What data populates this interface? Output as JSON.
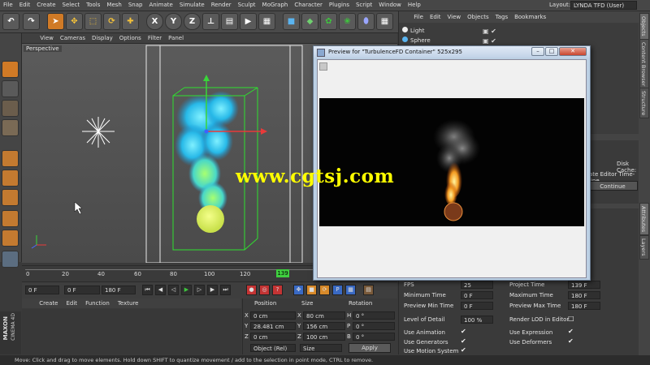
{
  "menu": [
    "File",
    "Edit",
    "Create",
    "Select",
    "Tools",
    "Mesh",
    "Snap",
    "Animate",
    "Simulate",
    "Render",
    "Sculpt",
    "MoGraph",
    "Character",
    "Plugins",
    "Script",
    "Window",
    "Help"
  ],
  "layout": {
    "label": "Layout:",
    "value": "LYNDA TFD (User)"
  },
  "toolbar_axis": [
    "X",
    "Y",
    "Z"
  ],
  "viewport": {
    "menu": [
      "View",
      "Cameras",
      "Display",
      "Options",
      "Filter",
      "Panel"
    ],
    "label": "Perspective"
  },
  "timeline": {
    "ticks": [
      "0",
      "20",
      "40",
      "60",
      "80",
      "100",
      "120",
      "140"
    ],
    "current": "139"
  },
  "transport": {
    "start": "0 F",
    "current": "0 F",
    "end": "180 F"
  },
  "material_menu": [
    "Create",
    "Edit",
    "Function",
    "Texture"
  ],
  "coords": {
    "headers": [
      "Position",
      "Size",
      "Rotation"
    ],
    "rows": [
      {
        "axis": "X",
        "pos": "0 cm",
        "size": "80 cm",
        "rot_axis": "H",
        "rot": "0 °"
      },
      {
        "axis": "Y",
        "pos": "28.481 cm",
        "size": "156 cm",
        "rot_axis": "P",
        "rot": "0 °"
      },
      {
        "axis": "Z",
        "pos": "0 cm",
        "size": "100 cm",
        "rot_axis": "B",
        "rot": "0 °"
      }
    ],
    "mode": "Object (Rel)",
    "size_mode": "Size",
    "apply": "Apply"
  },
  "brand": {
    "line1": "MAXON",
    "line2": "CINEMA 4D"
  },
  "status": "Move: Click and drag to move elements. Hold down SHIFT to quantize movement / add to the selection in point mode, CTRL to remove.",
  "objects": {
    "menu": [
      "File",
      "Edit",
      "View",
      "Objects",
      "Tags",
      "Bookmarks"
    ],
    "items": [
      "Light",
      "Sphere"
    ]
  },
  "side_tabs_top": [
    "Objects",
    "Content Browser",
    "Structure"
  ],
  "side_tabs_bottom": [
    "Attributes",
    "Layers"
  ],
  "attributes": {
    "disk_cache": "Disk Cache:",
    "editor_timeline": "ate Editor Time-line",
    "continue": "Continue",
    "rows_left": [
      {
        "label": "FPS",
        "value": "25"
      },
      {
        "label": "Minimum Time",
        "value": "0 F"
      },
      {
        "label": "Preview Min Time",
        "value": "0 F"
      }
    ],
    "rows_right": [
      {
        "label": "Project Time",
        "value": "139 F"
      },
      {
        "label": "Maximum Time",
        "value": "180 F"
      },
      {
        "label": "Preview Max Time",
        "value": "180 F"
      }
    ],
    "lod_label": "Level of Detail",
    "lod_value": "100 %",
    "render_lod": "Render LOD in Editor",
    "checks_left": [
      "Use Animation",
      "Use Generators",
      "Use Motion System"
    ],
    "checks_right": [
      "Use Expression",
      "Use Deformers"
    ]
  },
  "preview": {
    "title": "Preview for \"TurbulenceFD Container\" 525x295"
  },
  "watermark": "www.cgtsj.com"
}
